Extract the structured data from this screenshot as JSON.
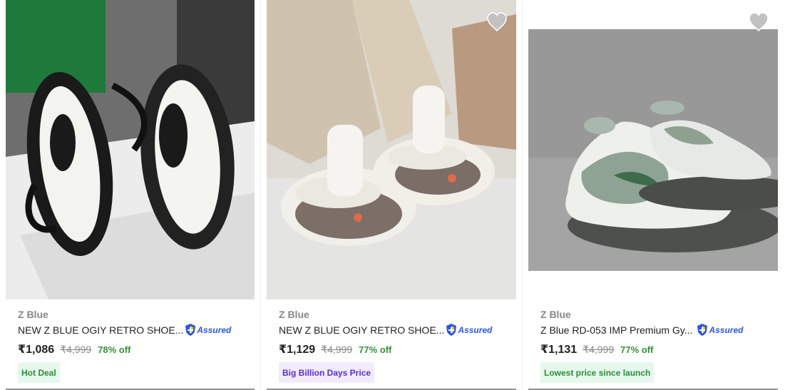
{
  "products": [
    {
      "brand": "Z Blue",
      "title": "NEW Z BLUE OGIY RETRO SHOE...",
      "assured": "Assured",
      "price": "₹1,086",
      "mrp": "₹4,999",
      "discount": "78% off",
      "tag": "Hot Deal",
      "image_icon": "black-white-sneaker-image"
    },
    {
      "brand": "Z Blue",
      "title": "NEW Z BLUE OGIY RETRO SHOE...",
      "assured": "Assured",
      "price": "₹1,129",
      "mrp": "₹4,999",
      "discount": "77% off",
      "tag": "Big Billion Days Price",
      "image_icon": "grey-cream-sneaker-image"
    },
    {
      "brand": "Z Blue",
      "title": "Z Blue RD-053 IMP Premium Gy...",
      "assured": "Assured",
      "price": "₹1,131",
      "mrp": "₹4,999",
      "discount": "77% off",
      "tag": "Lowest price since launch",
      "image_icon": "grey-green-sneaker-image"
    }
  ],
  "colors": {
    "price_off": "#388e3c",
    "assured_blue": "#2a55e5",
    "wishlist_grey": "#c2c2c2"
  }
}
